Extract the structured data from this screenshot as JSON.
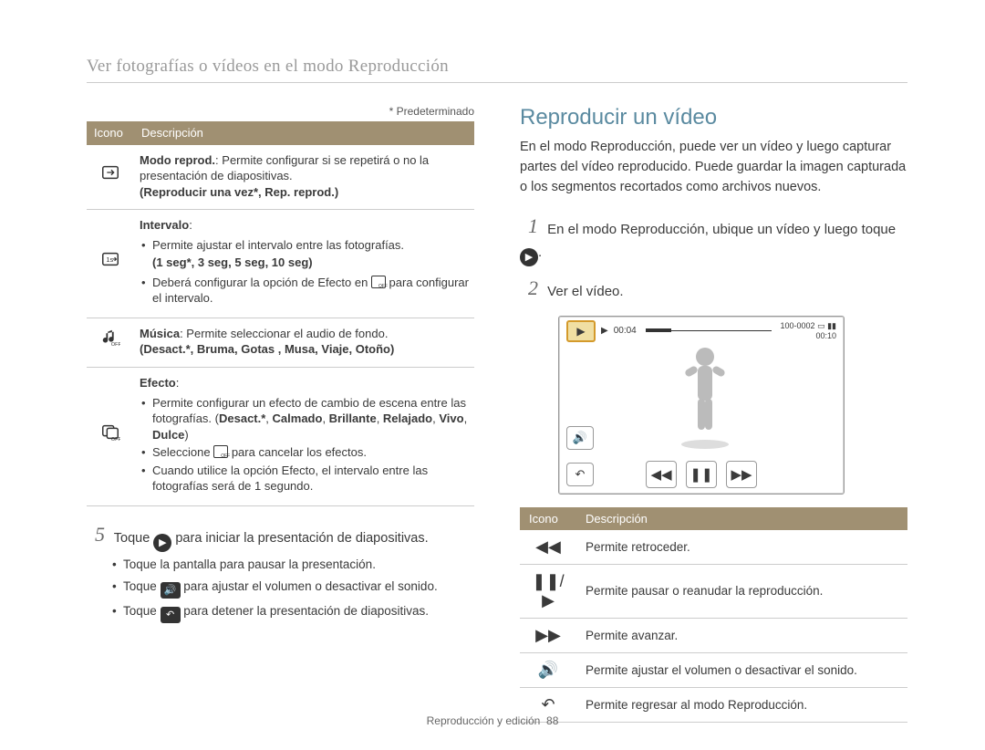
{
  "breadcrumb": "Ver fotografías o vídeos en el modo Reproducción",
  "default_note": "* Predeterminado",
  "left_table": {
    "headers": [
      "Icono",
      "Descripción"
    ],
    "rows": [
      {
        "icon_name": "repeat-icon",
        "title_bold": "Modo reprod.",
        "title_rest": ": Permite configurar si se repetirá o no la presentación de diapositivas.",
        "options_line": "(Reproducir una vez*, Rep. reprod.)"
      },
      {
        "icon_name": "interval-icon",
        "title_bold": "Intervalo",
        "title_rest": ":",
        "bullets": [
          "Permite ajustar el intervalo entre las fotografías.",
          "Deberá configurar la opción de Efecto en  para configurar el intervalo."
        ],
        "options_line_mid": "(1 seg*, 3 seg, 5 seg, 10 seg)",
        "icon_in_bullet_name": "effect-off-icon"
      },
      {
        "icon_name": "music-off-icon",
        "title_bold": "Música",
        "title_rest": ": Permite seleccionar el audio de fondo.",
        "options_line": "(Desact.*, Bruma, Gotas , Musa, Viaje, Otoño)"
      },
      {
        "icon_name": "effect-off-icon",
        "title_bold": "Efecto",
        "title_rest": ":",
        "bullets": [
          "Permite configurar un efecto de cambio de escena entre las fotografías. (Desact.*, Calmado, Brillante, Relajado, Vivo, Dulce)",
          "Seleccione  para cancelar los efectos.",
          "Cuando utilice la opción Efecto, el intervalo entre las fotografías será de 1 segundo."
        ],
        "bold_in_bullet1": [
          "Desact.*",
          "Calmado",
          "Brillante",
          "Relajado",
          "Vivo",
          "Dulce"
        ],
        "icon_in_bullet_name": "effect-off-icon"
      }
    ]
  },
  "step5": {
    "num": "5",
    "text_before_icon": "Toque ",
    "text_after_icon": " para iniciar la presentación de diapositivas.",
    "play_icon_name": "play-circle-icon",
    "subs": [
      {
        "text": "Toque la pantalla para pausar la presentación."
      },
      {
        "text_pre": "Toque ",
        "icon_name": "volume-icon",
        "text_post": " para ajustar el volumen o desactivar el sonido."
      },
      {
        "text_pre": "Toque ",
        "icon_name": "back-icon",
        "text_post": " para detener la presentación de diapositivas."
      }
    ]
  },
  "right": {
    "heading": "Reproducir un vídeo",
    "intro": "En el modo Reproducción, puede ver un vídeo y luego capturar partes del vídeo reproducido. Puede guardar la imagen capturada o los segmentos recortados como archivos nuevos.",
    "step1": {
      "num": "1",
      "text_pre": "En el modo Reproducción, ubique un vídeo y luego toque ",
      "icon_name": "play-circle-icon",
      "text_post": "."
    },
    "step2": {
      "num": "2",
      "text": "Ver el vídeo."
    },
    "hud": {
      "play_thumb_icon": "play-icon",
      "current_time": "00:04",
      "file_number": "100-0002",
      "total_time": "00:10",
      "memory_icon_name": "memory-icon",
      "battery_icon_name": "battery-icon"
    },
    "icon_table": {
      "headers": [
        "Icono",
        "Descripción"
      ],
      "rows": [
        {
          "icon_name": "rewind-icon",
          "glyph": "◀◀",
          "desc": "Permite retroceder."
        },
        {
          "icon_name": "pause-play-icon",
          "glyph": "❚❚/▶",
          "desc": "Permite pausar o reanudar la reproducción."
        },
        {
          "icon_name": "forward-icon",
          "glyph": "▶▶",
          "desc": "Permite avanzar."
        },
        {
          "icon_name": "volume-icon",
          "glyph": "🔊",
          "desc": "Permite ajustar el volumen o desactivar el sonido."
        },
        {
          "icon_name": "back-icon",
          "glyph": "↶",
          "desc": "Permite regresar al modo Reproducción."
        }
      ]
    }
  },
  "footer": {
    "text": "Reproducción y edición",
    "page": "88"
  }
}
